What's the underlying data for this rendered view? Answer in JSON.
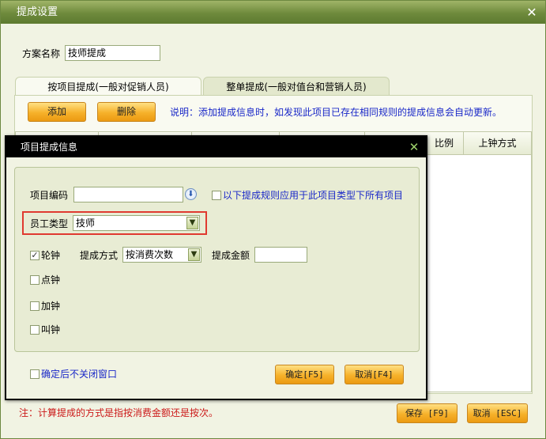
{
  "window": {
    "title": "提成设置"
  },
  "scheme": {
    "label": "方案名称",
    "value": "技师提成"
  },
  "tabs": [
    {
      "label": "按项目提成(一般对促销人员)"
    },
    {
      "label": "整单提成(一般对值台和营销人员)"
    }
  ],
  "toolbar": {
    "add_label": "添加",
    "delete_label": "删除",
    "note": "说明：添加提成信息时，如发现此项目已存在相同规则的提成信息会自动更新。"
  },
  "grid": {
    "columns_visible": [
      "比例",
      "上钟方式"
    ]
  },
  "footer": {
    "note": "注：计算提成的方式是指按消费金额还是按次。",
    "save_label": "保存 [F9]",
    "cancel_label": "取消 [ESC]"
  },
  "dialog": {
    "title": "项目提成信息",
    "item_code": {
      "label": "项目编码",
      "value": ""
    },
    "apply_all": {
      "label": "以下提成规则应用于此项目类型下所有项目",
      "checked": false
    },
    "employee_type": {
      "label": "员工类型",
      "value": "技师"
    },
    "options": [
      {
        "label": "轮钟",
        "checked": true
      },
      {
        "label": "点钟",
        "checked": false
      },
      {
        "label": "加钟",
        "checked": false
      },
      {
        "label": "叫钟",
        "checked": false
      }
    ],
    "method": {
      "label": "提成方式",
      "value": "按消费次数"
    },
    "amount": {
      "label": "提成金额",
      "value": ""
    },
    "keep_open": {
      "label": "确定后不关闭窗口",
      "checked": false
    },
    "ok_label": "确定[F5]",
    "cancel_label": "取消[F4]"
  },
  "colors": {
    "title_bar": "#6e8a3c",
    "accent": "#f6b12a",
    "note_blue": "#1a28c8",
    "note_red": "#cc1a1a",
    "highlight": "#e03a30"
  }
}
